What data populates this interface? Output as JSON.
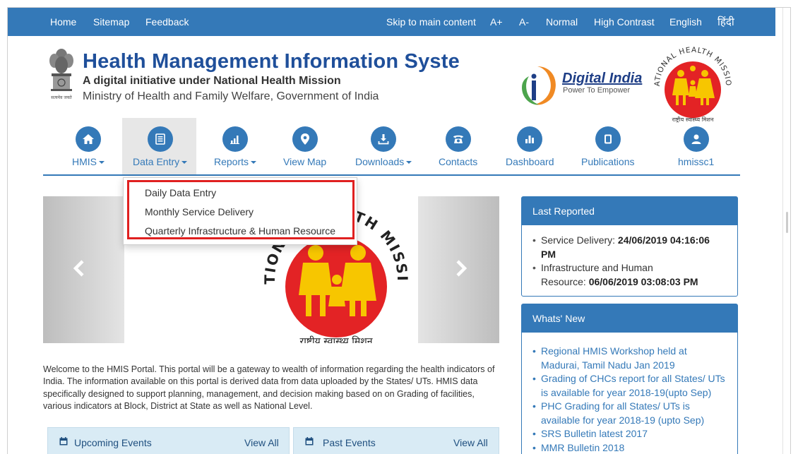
{
  "topbar": {
    "home": "Home",
    "sitemap": "Sitemap",
    "feedback": "Feedback",
    "skip": "Skip to main content",
    "font_plus": "A+",
    "font_minus": "A-",
    "normal": "Normal",
    "high_contrast": "High Contrast",
    "english": "English",
    "hindi": "हिंदी"
  },
  "header": {
    "title": "Health Management Information System",
    "subtitle": "A digital initiative under National Health Mission",
    "ministry": "Ministry of Health and Family Welfare, Government of India",
    "emblem_caption": "सत्यमेव जयते",
    "digital_india": "Digital India",
    "digital_india_tag": "Power To Empower",
    "nhm_ring_text": "NATIONAL HEALTH MISSION",
    "nhm_hindi": "राष्ट्रीय स्वास्थ्य मिशन"
  },
  "nav": {
    "items": [
      {
        "label": "HMIS",
        "icon": "home-icon",
        "caret": true
      },
      {
        "label": "Data Entry",
        "icon": "form-icon",
        "caret": true
      },
      {
        "label": "Reports",
        "icon": "bar-chart-icon",
        "caret": true
      },
      {
        "label": "View Map",
        "icon": "map-marker-icon",
        "caret": false
      },
      {
        "label": "Downloads",
        "icon": "download-icon",
        "caret": true
      },
      {
        "label": "Contacts",
        "icon": "phone-icon",
        "caret": false
      },
      {
        "label": "Dashboard",
        "icon": "dashboard-icon",
        "caret": false
      },
      {
        "label": "Publications",
        "icon": "book-icon",
        "caret": false
      },
      {
        "label": "hmissc1",
        "icon": "user-icon",
        "caret": false
      }
    ],
    "active": "Data Entry"
  },
  "dropdown": {
    "items": [
      "Daily Data Entry",
      "Monthly Service Delivery",
      "Quarterly Infrastructure & Human Resource"
    ]
  },
  "carousel": {
    "ring_text": "NATIONAL HEALTH MISSION",
    "hindi": "राष्ट्रीय स्वास्थ्य मिशन"
  },
  "welcome": "Welcome to the HMIS Portal. This portal will be a gateway to wealth of information regarding the health indicators of India. The information available on this portal is derived data from data uploaded by the States/ UTs. HMIS data specifically designed to support planning, management, and decision making based on on Grading of facilities, various indicators at Block, District at State as well as National Level.",
  "events": {
    "upcoming": "Upcoming Events",
    "past": "Past Events",
    "view_all": "View All"
  },
  "last_reported": {
    "title": "Last Reported",
    "service_label": "Service Delivery: ",
    "service_value": "24/06/2019 04:16:06 PM",
    "infra_label_1": "Infrastructure and Human",
    "infra_label_2": "Resource: ",
    "infra_value": "06/06/2019 03:08:03 PM"
  },
  "whats_new": {
    "title": "Whats' New",
    "items": [
      "Regional HMIS Workshop held at Madurai, Tamil Nadu Jan 2019",
      "Grading of CHCs report for all States/ UTs is available for year 2018-19(upto Sep)",
      "PHC Grading for all States/ UTs is available for year 2018-19 (upto Sep)",
      "SRS Bulletin latest 2017",
      "MMR Bulletin 2018"
    ]
  },
  "colors": {
    "primary": "#3479b8",
    "title_blue": "#1f4f9a",
    "highlight_red": "#e02020",
    "nhm_red": "#e32325",
    "nhm_yellow": "#f7c600"
  }
}
